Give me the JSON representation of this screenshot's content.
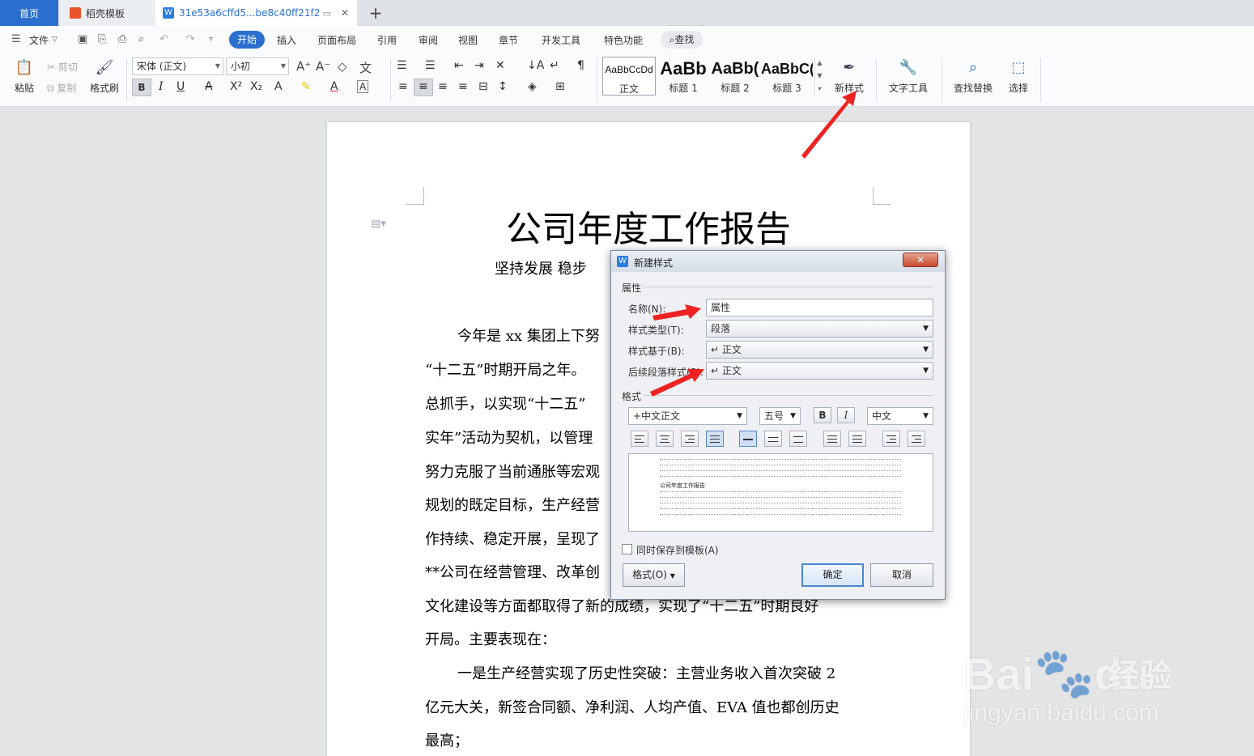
{
  "tabs": {
    "home": "首页",
    "template": "稻壳模板",
    "doc": "31e53a6cffd5...be8c40ff21f2",
    "doc_icon": "W",
    "plus": "+",
    "close": "✕"
  },
  "menubar": {
    "file": "文件",
    "items": [
      "开始",
      "插入",
      "页面布局",
      "引用",
      "审阅",
      "视图",
      "章节",
      "开发工具",
      "特色功能"
    ],
    "find": "查找"
  },
  "ribbon": {
    "paste": "粘贴",
    "cut": "剪切",
    "copy": "复制",
    "format_painter": "格式刷",
    "font_name": "宋体 (正文)",
    "font_size": "小初",
    "styles": [
      {
        "preview": "AaBbCcDd",
        "label": "正文"
      },
      {
        "preview": "AaBb",
        "label": "标题 1"
      },
      {
        "preview": "AaBb(",
        "label": "标题 2"
      },
      {
        "preview": "AaBbC(",
        "label": "标题 3"
      }
    ],
    "new_style": "新样式",
    "text_tools": "文字工具",
    "find_replace": "查找替换",
    "select": "选择"
  },
  "document": {
    "title": "公司年度工作报告",
    "subtitle": "坚持发展    稳步",
    "lines": [
      "今年是 xx 集团上下努",
      "“十二五”时期开局之年。",
      "总抓手，以实现“十二五”",
      "实年”活动为契机，以管理",
      "努力克服了当前通胀等宏观",
      "规划的既定目标，生产经营",
      "作持续、稳定开展，呈现了",
      "**公司在经营管理、改革创",
      "文化建设等方面都取得了新的成绩，实现了“十二五”时期良好",
      "开局。主要表现在：",
      "一是生产经营实现了历史性突破：主营业务收入首次突破 2",
      "亿元大关，新签合同额、净利润、人均产值、EVA 值也都创历史",
      "最高；"
    ]
  },
  "dialog": {
    "title": "新建样式",
    "close": "✕",
    "section_props": "属性",
    "name_label": "名称(N):",
    "name_value": "属性",
    "type_label": "样式类型(T):",
    "type_value": "段落",
    "based_label": "样式基于(B):",
    "based_value": "↵ 正文",
    "next_label": "后续段落样式(S):",
    "next_value": "↵ 正文",
    "section_format": "格式",
    "font": "+中文正文",
    "size": "五号",
    "bold": "B",
    "italic": "I",
    "script": "中文",
    "preview_text": "公司年度工作报告",
    "save_template": "同时保存到模板(A)",
    "format_btn": "格式(O)",
    "ok": "确定",
    "cancel": "取消"
  },
  "watermark": {
    "brand": "Bai",
    "brand2": "du",
    "jy": "经验",
    "url": "jingyan.baidu.com"
  }
}
